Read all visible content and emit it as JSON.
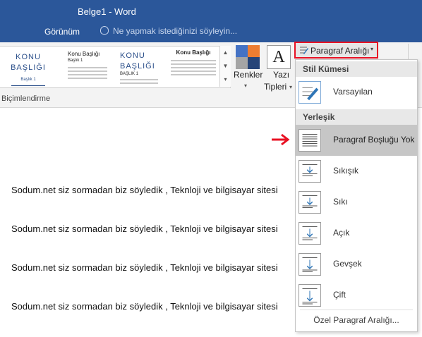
{
  "window": {
    "title": "Belge1 - Word"
  },
  "menu": {
    "tab_view": "Görünüm",
    "tell_me": "Ne yapmak istediğinizi söyleyin..."
  },
  "ribbon": {
    "style_gallery": [
      {
        "heading": "KONU\nBAŞLIĞI",
        "subheading": "Başlık 1"
      },
      {
        "heading": "Konu Başlığı",
        "subheading": "Başlık 1"
      },
      {
        "heading": "KONU\nBAŞLIĞI",
        "subheading": "BAŞLIK 1"
      },
      {
        "heading": "Konu Başlığı",
        "subheading": ""
      }
    ],
    "colors_label": "Renkler",
    "fonts_label_line1": "Yazı",
    "fonts_label_line2": "Tipleri",
    "fonts_glyph": "A",
    "group_label": "Biçimlendirme",
    "colors_swatches": [
      "#4472c4",
      "#ed7d31",
      "#a5a5a5",
      "#264478"
    ]
  },
  "spacing_button": {
    "label": "Paragraf Aralığı"
  },
  "dropdown": {
    "section_style_set": "Stil Kümesi",
    "default_item": "Varsayılan",
    "section_builtin": "Yerleşik",
    "items": [
      {
        "label": "Paragraf Boşluğu Yok",
        "selected": true,
        "level": 0
      },
      {
        "label": "Sıkışık",
        "selected": false,
        "level": 1
      },
      {
        "label": "Sıkı",
        "selected": false,
        "level": 2
      },
      {
        "label": "Açık",
        "selected": false,
        "level": 3
      },
      {
        "label": "Gevşek",
        "selected": false,
        "level": 4
      },
      {
        "label": "Çift",
        "selected": false,
        "level": 5
      }
    ],
    "custom_link": "Özel Paragraf Aralığı..."
  },
  "document": {
    "lines": [
      "Sodum.net siz sormadan biz söyledik , Teknloji ve bilgisayar sitesi",
      "Sodum.net siz sormadan biz söyledik , Teknloji ve bilgisayar sitesi",
      "Sodum.net siz sormadan biz söyledik , Teknloji ve bilgisayar sitesi",
      "Sodum.net siz sormadan biz söyledik , Teknloji ve bilgisayar sitesi"
    ]
  },
  "colors": {
    "title_bar": "#2b579a",
    "highlight": "#e81123",
    "accent_blue": "#2e75b6"
  }
}
